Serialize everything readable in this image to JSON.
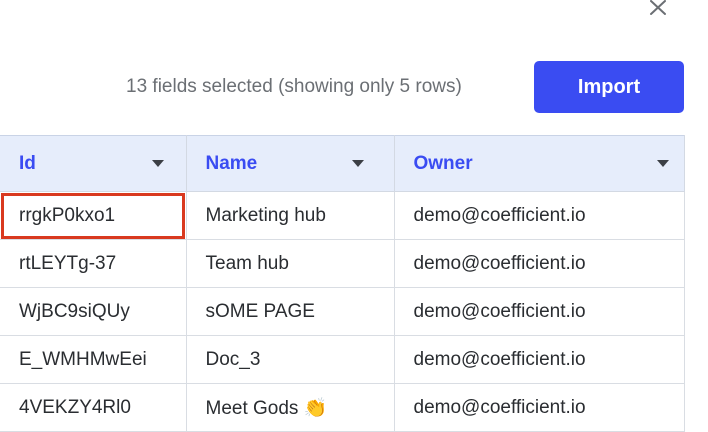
{
  "status_text": "13 fields selected (showing only 5 rows)",
  "import_label": "Import",
  "colors": {
    "accent": "#3a4cf2",
    "header_bg": "#e6edfb",
    "selection": "#d9391f"
  },
  "icons": {
    "close": "close-icon",
    "sort": "chevron-down-icon"
  },
  "table": {
    "columns": [
      "Id",
      "Name",
      "Owner"
    ],
    "rows": [
      {
        "id": "rrgkP0kxo1",
        "name": "Marketing hub",
        "owner": "demo@coefficient.io"
      },
      {
        "id": "rtLEYTg-37",
        "name": "Team hub",
        "owner": "demo@coefficient.io"
      },
      {
        "id": "WjBC9siQUy",
        "name": "sOME PAGE",
        "owner": "demo@coefficient.io"
      },
      {
        "id": "E_WMHMwEei",
        "name": "Doc_3",
        "owner": "demo@coefficient.io"
      },
      {
        "id": "4VEKZY4Rl0",
        "name": "Meet Gods 👏",
        "owner": "demo@coefficient.io"
      }
    ]
  }
}
